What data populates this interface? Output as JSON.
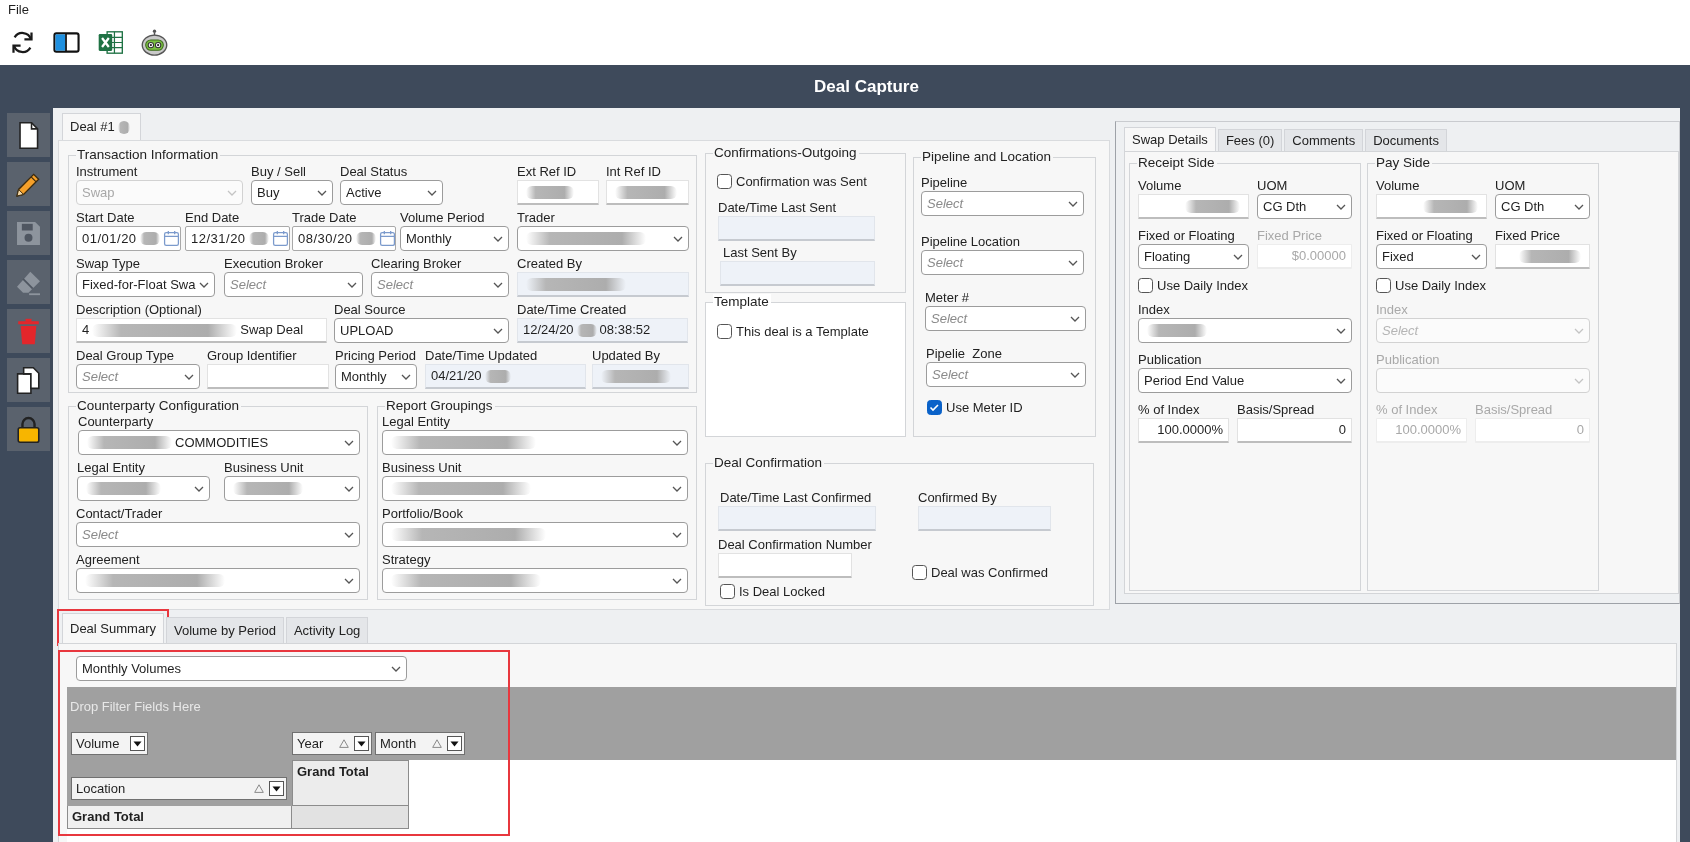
{
  "menu": [
    {
      "label": "File"
    }
  ],
  "window": {
    "title": "Deal Capture"
  },
  "sidebar_buttons": [
    {
      "disabled": false
    },
    {
      "disabled": false
    },
    {
      "disabled": true
    },
    {
      "disabled": true
    },
    {
      "disabled": false
    },
    {
      "disabled": false
    },
    {
      "disabled": false
    }
  ],
  "deal_tabs": [
    {
      "label": "Deal #1",
      "selected": true,
      "blurred": true
    }
  ],
  "transaction_information": {
    "title": "Transaction Information",
    "fields": [
      {
        "kind": "select",
        "label": "Instrument",
        "value": "Swap",
        "disabled": true,
        "blurred": false
      },
      {
        "kind": "select",
        "label": "Buy / Sell",
        "value": "Buy",
        "disabled": false,
        "blurred": false
      },
      {
        "kind": "select",
        "label": "Deal Status",
        "value": "Active",
        "disabled": false,
        "blurred": false
      },
      {
        "kind": "input",
        "label": "Ext Ref ID",
        "disabled": false,
        "blurred": true
      },
      {
        "kind": "input",
        "label": "Int Ref ID",
        "disabled": false,
        "blurred": true
      },
      {
        "kind": "date",
        "label": "Start Date",
        "value": "01/01/20",
        "disabled": false,
        "blurred": true
      },
      {
        "kind": "date",
        "label": "End Date",
        "value": "12/31/20",
        "disabled": false,
        "blurred": true
      },
      {
        "kind": "date",
        "label": "Trade Date",
        "value": "08/30/20",
        "disabled": false,
        "blurred": true
      },
      {
        "kind": "select",
        "label": "Volume Period",
        "value": "Monthly",
        "disabled": false,
        "blurred": false
      },
      {
        "kind": "select",
        "label": "Trader",
        "disabled": false,
        "blurred": true
      },
      {
        "kind": "select",
        "label": "Swap Type",
        "value": "Fixed-for-Float Swa",
        "disabled": false,
        "blurred": false
      },
      {
        "kind": "select",
        "label": "Execution Broker",
        "placeholder": "Select",
        "disabled": false,
        "blurred": false
      },
      {
        "kind": "select",
        "label": "Clearing Broker",
        "placeholder": "Select",
        "disabled": false,
        "blurred": false
      },
      {
        "kind": "readonly",
        "label": "Created By",
        "disabled": false,
        "blurred": true
      },
      {
        "kind": "input",
        "label": "Description (Optional)",
        "value": "4",
        "value_after": "Swap Deal",
        "disabled": false,
        "blurred": true
      },
      {
        "kind": "select",
        "label": "Deal Source",
        "value": "UPLOAD",
        "disabled": false,
        "blurred": false
      },
      {
        "kind": "readonly",
        "label": "Date/Time Created",
        "value": "12/24/20",
        "value_after": "08:38:52",
        "disabled": false,
        "blurred": true
      },
      {
        "kind": "select",
        "label": "Deal Group Type",
        "placeholder": "Select",
        "disabled": false,
        "blurred": false
      },
      {
        "kind": "input",
        "label": "Group Identifier",
        "disabled": false,
        "blurred": false
      },
      {
        "kind": "select",
        "label": "Pricing Period",
        "value": "Monthly",
        "disabled": false,
        "blurred": false
      },
      {
        "kind": "readonly",
        "label": "Date/Time Updated",
        "value": "04/21/20",
        "disabled": false,
        "blurred": true
      },
      {
        "kind": "readonly",
        "label": "Updated By",
        "disabled": false,
        "blurred": true
      }
    ]
  },
  "counterparty_configuration": {
    "title": "Counterparty Configuration",
    "fields": [
      {
        "kind": "select",
        "label": "Counterparty",
        "value_after": "COMMODITIES",
        "disabled": false,
        "blurred": true
      },
      {
        "kind": "select",
        "label": "Legal Entity",
        "disabled": false,
        "blurred": true
      },
      {
        "kind": "select",
        "label": "Business Unit",
        "disabled": false,
        "blurred": true
      },
      {
        "kind": "select",
        "label": "Contact/Trader",
        "placeholder": "Select",
        "disabled": false,
        "blurred": false
      },
      {
        "kind": "select",
        "label": "Agreement",
        "disabled": false,
        "blurred": true
      }
    ]
  },
  "report_groupings": {
    "title": "Report Groupings",
    "fields": [
      {
        "kind": "select",
        "label": "Legal Entity",
        "disabled": false,
        "blurred": true
      },
      {
        "kind": "select",
        "label": "Business Unit",
        "disabled": false,
        "blurred": true
      },
      {
        "kind": "select",
        "label": "Portfolio/Book",
        "disabled": false,
        "blurred": true
      },
      {
        "kind": "select",
        "label": "Strategy",
        "disabled": false,
        "blurred": true
      }
    ]
  },
  "confirmations_outgoing": {
    "title": "Confirmations-Outgoing",
    "fields": [
      {
        "kind": "checkbox",
        "label": "Confirmation was Sent",
        "checked": false,
        "disabled": false,
        "blurred": false
      },
      {
        "kind": "readonly",
        "label": "Date/Time Last Sent",
        "disabled": false,
        "blurred": false
      },
      {
        "kind": "readonly",
        "label": "Last Sent By",
        "disabled": false,
        "blurred": false
      }
    ]
  },
  "template": {
    "title": "Template",
    "fields": [
      {
        "kind": "checkbox",
        "label": "This deal is a Template",
        "checked": false,
        "disabled": false,
        "blurred": false
      }
    ]
  },
  "pipeline_and_location": {
    "title": "Pipeline and Location",
    "fields": [
      {
        "kind": "select",
        "label": "Pipeline",
        "placeholder": "Select",
        "disabled": false,
        "blurred": false
      },
      {
        "kind": "select",
        "label": "Pipeline Location",
        "placeholder": "Select",
        "disabled": false,
        "blurred": false
      },
      {
        "kind": "select",
        "label": "Meter #",
        "placeholder": "Select",
        "disabled": false,
        "blurred": false
      },
      {
        "kind": "select",
        "label": "Pipelie  Zone",
        "placeholder": "Select",
        "disabled": false,
        "blurred": false
      },
      {
        "kind": "checkbox",
        "label": "Use Meter ID",
        "checked": true,
        "disabled": false,
        "blurred": false
      }
    ]
  },
  "deal_confirmation": {
    "title": "Deal Confirmation",
    "fields": [
      {
        "kind": "readonly",
        "label": "Date/Time Last Confirmed",
        "disabled": false,
        "blurred": false
      },
      {
        "kind": "readonly",
        "label": "Confirmed By",
        "disabled": false,
        "blurred": false
      },
      {
        "kind": "input",
        "label": "Deal Confirmation Number",
        "disabled": false,
        "blurred": false
      },
      {
        "kind": "checkbox",
        "label": "Deal was Confirmed",
        "checked": false,
        "disabled": false,
        "blurred": false
      },
      {
        "kind": "checkbox",
        "label": "Is Deal Locked",
        "checked": false,
        "disabled": false,
        "blurred": false
      }
    ]
  },
  "detail_tabs": [
    {
      "label": "Swap Details",
      "selected": true
    },
    {
      "label": "Fees (0)",
      "selected": false
    },
    {
      "label": "Comments",
      "selected": false
    },
    {
      "label": "Documents",
      "selected": false
    }
  ],
  "receipt_side": {
    "title": "Receipt Side",
    "fields": [
      {
        "kind": "input",
        "label": "Volume",
        "disabled": false,
        "blurred": true
      },
      {
        "kind": "select",
        "label": "UOM",
        "value": "CG Dth",
        "disabled": false,
        "blurred": false
      },
      {
        "kind": "select",
        "label": "Fixed or Floating",
        "value": "Floating",
        "disabled": false,
        "blurred": false
      },
      {
        "kind": "input",
        "label": "Fixed Price",
        "value": "$0.00000",
        "disabled": true,
        "blurred": false
      },
      {
        "kind": "checkbox",
        "label": "Use Daily Index",
        "checked": false,
        "disabled": false,
        "blurred": false
      },
      {
        "kind": "select",
        "label": "Index",
        "disabled": false,
        "blurred": true
      },
      {
        "kind": "select",
        "label": "Publication",
        "value": "Period End Value",
        "disabled": false,
        "blurred": false
      },
      {
        "kind": "input",
        "label": "% of Index",
        "value": "100.0000%",
        "disabled": false,
        "blurred": false
      },
      {
        "kind": "input",
        "label": "Basis/Spread",
        "value": "0",
        "disabled": false,
        "blurred": false
      }
    ]
  },
  "pay_side": {
    "title": "Pay Side",
    "fields": [
      {
        "kind": "input",
        "label": "Volume",
        "disabled": false,
        "blurred": true
      },
      {
        "kind": "select",
        "label": "UOM",
        "value": "CG Dth",
        "disabled": false,
        "blurred": false
      },
      {
        "kind": "select",
        "label": "Fixed or Floating",
        "value": "Fixed",
        "disabled": false,
        "blurred": false
      },
      {
        "kind": "input",
        "label": "Fixed Price",
        "disabled": false,
        "blurred": true
      },
      {
        "kind": "checkbox",
        "label": "Use Daily Index",
        "checked": false,
        "disabled": false,
        "blurred": false
      },
      {
        "kind": "select",
        "label": "Index",
        "placeholder": "Select",
        "disabled": true,
        "blurred": false
      },
      {
        "kind": "select",
        "label": "Publication",
        "disabled": true,
        "blurred": false
      },
      {
        "kind": "input",
        "label": "% of Index",
        "value": "100.0000%",
        "disabled": true,
        "blurred": false
      },
      {
        "kind": "input",
        "label": "Basis/Spread",
        "value": "0",
        "disabled": true,
        "blurred": false
      }
    ]
  },
  "bottom_tabs": [
    {
      "label": "Deal Summary",
      "selected": true,
      "highlighted": true
    },
    {
      "label": "Volume by Period",
      "selected": false,
      "highlighted": false
    },
    {
      "label": "Activity Log",
      "selected": false,
      "highlighted": false
    }
  ],
  "pivot": {
    "report": {
      "kind": "select",
      "value": "Monthly Volumes",
      "disabled": false,
      "blurred": false
    },
    "filter_hint": "Drop Filter Fields Here",
    "data_fields": [
      {
        "label": "Volume"
      }
    ],
    "column_fields": [
      {
        "label": "Year"
      },
      {
        "label": "Month"
      }
    ],
    "row_fields": [
      {
        "label": "Location"
      }
    ],
    "column_total": "Grand Total",
    "row_total": "Grand Total",
    "highlighted": true
  }
}
